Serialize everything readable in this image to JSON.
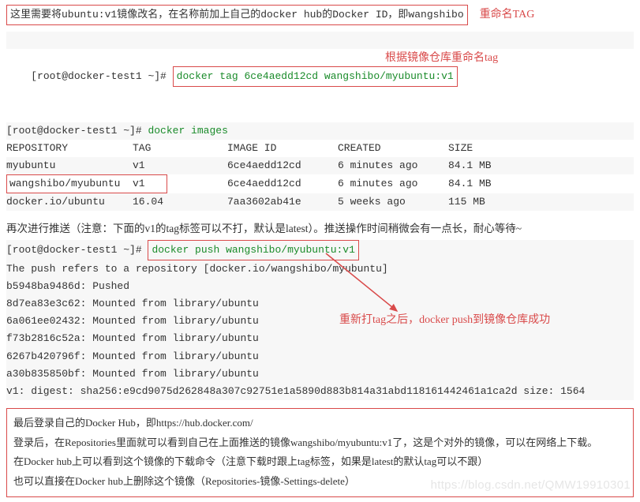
{
  "top": {
    "rename_sentence": "这里需要将ubuntu:v1镜像改名，在名称前加上自己的docker hub的Docker ID，即wangshibo",
    "rename_label": "重命名TAG"
  },
  "tagline": {
    "prompt": "[root@docker-test1 ~]#",
    "cmd": "docker tag 6ce4aedd12cd wangshibo/myubuntu:v1",
    "annot": "根据镜像仓库重命名tag"
  },
  "imagesline": {
    "prompt": "[root@docker-test1 ~]#",
    "cmd": "docker images"
  },
  "table": {
    "headers": {
      "repo": "REPOSITORY",
      "tag": "TAG",
      "id": "IMAGE ID",
      "created": "CREATED",
      "size": "SIZE"
    },
    "rows": [
      {
        "repo": "myubuntu",
        "tag": "v1",
        "id": "6ce4aedd12cd",
        "created": "6 minutes ago",
        "size": "84.1 MB"
      },
      {
        "repo": "wangshibo/myubuntu",
        "tag": "v1",
        "id": "6ce4aedd12cd",
        "created": "6 minutes ago",
        "size": "84.1 MB"
      },
      {
        "repo": "docker.io/ubuntu",
        "tag": "16.04",
        "id": "7aa3602ab41e",
        "created": "5 weeks ago",
        "size": "115 MB"
      }
    ]
  },
  "push_note": "再次进行推送（注意：下面的v1的tag标签可以不打，默认是latest）。推送操作时间稍微会有一点长，耐心等待~",
  "pushline": {
    "prompt": "[root@docker-test1 ~]#",
    "cmd": "docker push wangshibo/myubuntu:v1"
  },
  "push_output": [
    "The push refers to a repository [docker.io/wangshibo/myubuntu]",
    "b5948ba9486d: Pushed",
    "8d7ea83e3c62: Mounted from library/ubuntu",
    "6a061ee02432: Mounted from library/ubuntu",
    "f73b2816c52a: Mounted from library/ubuntu",
    "6267b420796f: Mounted from library/ubuntu",
    "a30b835850bf: Mounted from library/ubuntu",
    "v1: digest: sha256:e9cd9075d262848a307c92751e1a5890d883b814a31abd118161442461a1ca2d size: 1564"
  ],
  "arrow_label": "重新打tag之后，docker push到镜像仓库成功",
  "final_box": [
    "最后登录自己的Docker Hub，即https://hub.docker.com/",
    "登录后，在Repositories里面就可以看到自己在上面推送的镜像wangshibo/myubuntu:v1了，这是个对外的镜像，可以在网络上下载。",
    "在Docker hub上可以看到这个镜像的下载命令（注意下载时跟上tag标签，如果是latest的默认tag可以不跟）",
    "也可以直接在Docker hub上删除这个镜像（Repositories-镜像-Settings-delete）"
  ],
  "watermark": "https://blog.csdn.net/QMW19910301"
}
